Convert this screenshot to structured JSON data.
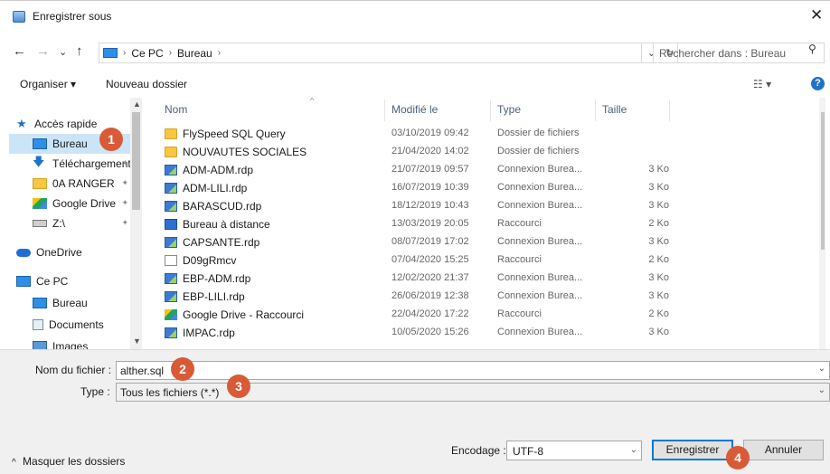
{
  "window": {
    "title": "Enregistrer sous",
    "close_glyph": "✕"
  },
  "nav": {
    "back": "←",
    "forward": "→",
    "recent": "⌄",
    "up": "↑",
    "crumbs": [
      "Ce PC",
      "Bureau"
    ],
    "refresh": "↻",
    "search_placeholder": "Rechercher dans : Bureau"
  },
  "toolbar": {
    "organize": "Organiser ▾",
    "new_folder": "Nouveau dossier",
    "view": "☷ ▾",
    "help": "?"
  },
  "sidebar": {
    "items": [
      {
        "label": "Accès rapide",
        "icon": "star-icon",
        "indent": 0,
        "pinned": false
      },
      {
        "label": "Bureau",
        "icon": "desktop-icon",
        "indent": 1,
        "pinned": true,
        "selected": true
      },
      {
        "label": "Téléchargements",
        "icon": "download-icon",
        "indent": 1,
        "pinned": true
      },
      {
        "label": "0A RANGER",
        "icon": "folder-icon",
        "indent": 1,
        "pinned": true
      },
      {
        "label": "Google Drive",
        "icon": "google-drive-icon",
        "indent": 1,
        "pinned": true
      },
      {
        "label": "Z:\\",
        "icon": "network-drive-icon",
        "indent": 1,
        "pinned": true
      },
      {
        "label": "OneDrive",
        "icon": "cloud-icon",
        "indent": 0,
        "pinned": false
      },
      {
        "label": "Ce PC",
        "icon": "computer-icon",
        "indent": 0,
        "pinned": false
      },
      {
        "label": "Bureau",
        "icon": "desktop-icon",
        "indent": 1,
        "pinned": false
      },
      {
        "label": "Documents",
        "icon": "documents-icon",
        "indent": 1,
        "pinned": false
      },
      {
        "label": "Images",
        "icon": "images-icon",
        "indent": 1,
        "pinned": false
      }
    ]
  },
  "columns": {
    "name": "Nom",
    "modified": "Modifié le",
    "type": "Type",
    "size": "Taille"
  },
  "files": [
    {
      "name": "FlySpeed SQL Query",
      "modified": "03/10/2019 09:42",
      "type": "Dossier de fichiers",
      "size": "",
      "icon": "folder"
    },
    {
      "name": "NOUVAUTES SOCIALES",
      "modified": "21/04/2020 14:02",
      "type": "Dossier de fichiers",
      "size": "",
      "icon": "folder"
    },
    {
      "name": "ADM-ADM.rdp",
      "modified": "21/07/2019 09:57",
      "type": "Connexion Burea...",
      "size": "3 Ko",
      "icon": "rdp"
    },
    {
      "name": "ADM-LILI.rdp",
      "modified": "16/07/2019 10:39",
      "type": "Connexion Burea...",
      "size": "3 Ko",
      "icon": "rdp"
    },
    {
      "name": "BARASCUD.rdp",
      "modified": "18/12/2019 10:43",
      "type": "Connexion Burea...",
      "size": "3 Ko",
      "icon": "rdp"
    },
    {
      "name": "Bureau à distance",
      "modified": "13/03/2019 20:05",
      "type": "Raccourci",
      "size": "2 Ko",
      "icon": "rd-short"
    },
    {
      "name": "CAPSANTE.rdp",
      "modified": "08/07/2019 17:02",
      "type": "Connexion Burea...",
      "size": "3 Ko",
      "icon": "rdp"
    },
    {
      "name": "D09gRmcv",
      "modified": "07/04/2020 15:25",
      "type": "Raccourci",
      "size": "2 Ko",
      "icon": "shortcut"
    },
    {
      "name": "EBP-ADM.rdp",
      "modified": "12/02/2020 21:37",
      "type": "Connexion Burea...",
      "size": "3 Ko",
      "icon": "rdp"
    },
    {
      "name": "EBP-LILI.rdp",
      "modified": "26/06/2019 12:38",
      "type": "Connexion Burea...",
      "size": "3 Ko",
      "icon": "rdp"
    },
    {
      "name": "Google Drive - Raccourci",
      "modified": "22/04/2020 17:22",
      "type": "Raccourci",
      "size": "2 Ko",
      "icon": "gdrive"
    },
    {
      "name": "IMPAC.rdp",
      "modified": "10/05/2020 15:26",
      "type": "Connexion Burea...",
      "size": "3 Ko",
      "icon": "rdp"
    }
  ],
  "form": {
    "filename_label": "Nom du fichier :",
    "filename_value": "alther.sql",
    "type_label": "Type :",
    "type_value": "Tous les fichiers  (*.*)",
    "encoding_label": "Encodage :",
    "encoding_value": "UTF-8",
    "save": "Enregistrer",
    "cancel": "Annuler",
    "hide_folders": "Masquer les dossiers"
  },
  "badges": [
    "1",
    "2",
    "3",
    "4"
  ],
  "colors": {
    "accent": "#0078d7",
    "badge": "#d85a37",
    "selection": "#cce4f7"
  }
}
